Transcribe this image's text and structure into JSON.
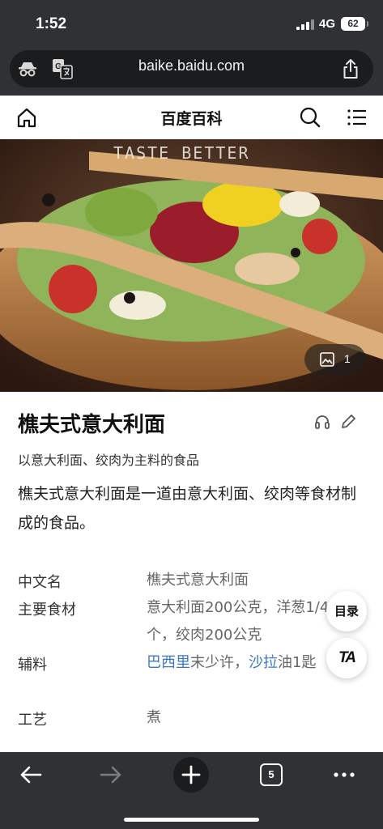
{
  "status": {
    "time": "1:52",
    "network": "4G",
    "battery": "62"
  },
  "browser": {
    "url": "baike.baidu.com",
    "tab_count": "5"
  },
  "site": {
    "title": "百度百科"
  },
  "hero": {
    "caption": "TASTE BETTER",
    "album_count": "1"
  },
  "article": {
    "title": "樵夫式意大利面",
    "subtitle": "以意大利面、绞肉为主料的食品",
    "summary": "樵夫式意大利面是一道由意大利面、绞肉等食材制成的食品。"
  },
  "infobox": {
    "rows": [
      {
        "label": "中文名",
        "value": "樵夫式意大利面"
      },
      {
        "label": "主要食材",
        "value": "意大利面200公克，洋葱1/4个，绞肉200公克"
      },
      {
        "label": "辅料",
        "link1": "巴西里",
        "text1": "末少许，",
        "link2": "沙拉",
        "text2": "油1匙"
      },
      {
        "label": "工艺",
        "value": "煮"
      }
    ]
  },
  "floating": {
    "toc_label": "目录",
    "ta_label": "TA"
  },
  "colors": {
    "chrome": "#2f3134",
    "link": "#3b76c6"
  }
}
